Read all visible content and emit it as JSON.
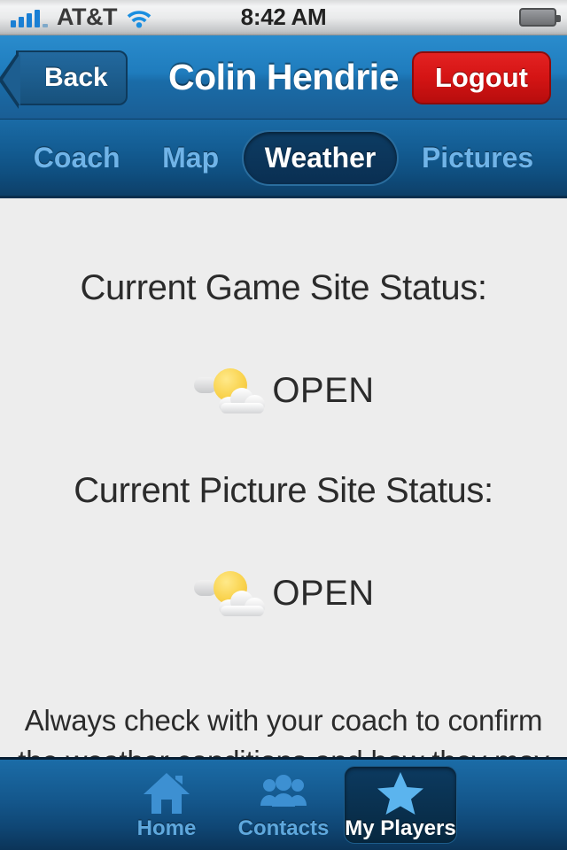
{
  "status_bar": {
    "carrier": "AT&T",
    "time": "8:42 AM",
    "signal_icon": "signal-bars-icon",
    "wifi_icon": "wifi-icon",
    "battery_icon": "battery-icon",
    "battery_level_percent": 55
  },
  "nav_bar": {
    "back_label": "Back",
    "title": "Colin Hendrie",
    "logout_label": "Logout",
    "logout_color": "#d41414"
  },
  "segments": [
    {
      "label": "Coach",
      "active": false
    },
    {
      "label": "Map",
      "active": false
    },
    {
      "label": "Weather",
      "active": true
    },
    {
      "label": "Pictures",
      "active": false
    }
  ],
  "content": {
    "game_site": {
      "heading": "Current Game Site Status:",
      "icon": "sun-behind-cloud-icon",
      "status": "OPEN"
    },
    "picture_site": {
      "heading": "Current Picture Site Status:",
      "icon": "sun-behind-cloud-icon",
      "status": "OPEN"
    },
    "disclaimer": "Always check with your coach to confirm the weather conditions and how they may affect"
  },
  "tab_bar": [
    {
      "label": "Home",
      "icon": "house-icon",
      "active": false
    },
    {
      "label": "Contacts",
      "icon": "people-icon",
      "active": false
    },
    {
      "label": "My Players",
      "icon": "star-icon",
      "active": true
    }
  ],
  "theme": {
    "nav_blue": "#1f7cbd",
    "segment_blue": "#135c92",
    "content_bg": "#ededed",
    "accent_blue": "#3d8fd0",
    "active_star_blue": "#5bb4ee"
  }
}
